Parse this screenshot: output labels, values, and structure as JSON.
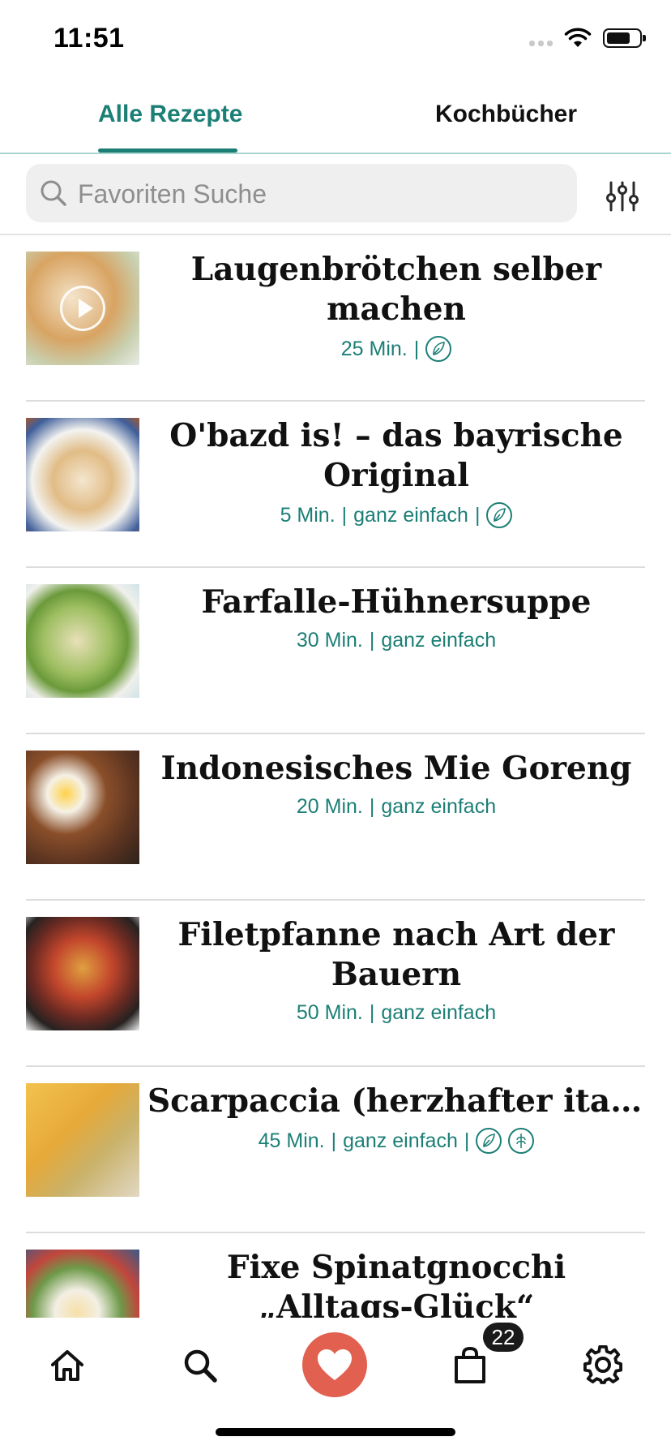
{
  "status_bar": {
    "time": "11:51"
  },
  "tabs": [
    {
      "label": "Alle Rezepte",
      "active": true
    },
    {
      "label": "Kochbücher",
      "active": false
    }
  ],
  "search": {
    "placeholder": "Favoriten Suche",
    "value": ""
  },
  "recipes": [
    {
      "title": "Laugenbrötchen selber machen",
      "time": "25 Min.",
      "difficulty": "",
      "badges": [
        "vegetarian-icon"
      ],
      "has_video": true
    },
    {
      "title": "O'bazd is! – das bayrische Original",
      "time": "5 Min.",
      "difficulty": "ganz einfach",
      "badges": [
        "vegetarian-icon"
      ],
      "has_video": false
    },
    {
      "title": "Farfalle-Hühnersuppe",
      "time": "30 Min.",
      "difficulty": "ganz einfach",
      "badges": [],
      "has_video": false
    },
    {
      "title": "Indonesisches Mie Goreng",
      "time": "20 Min.",
      "difficulty": "ganz einfach",
      "badges": [],
      "has_video": false
    },
    {
      "title": "Filetpfanne nach Art der Bauern",
      "time": "50 Min.",
      "difficulty": "ganz einfach",
      "badges": [],
      "has_video": false
    },
    {
      "title": "Scarpaccia (herzhafter italienischer Zucchinikuc…",
      "time": "45 Min.",
      "difficulty": "ganz einfach",
      "badges": [
        "vegetarian-icon",
        "gluten-free-icon"
      ],
      "has_video": false
    },
    {
      "title": "Fixe Spinatgnocchi „Alltags-Glück“",
      "time": "",
      "difficulty": "",
      "badges": [],
      "has_video": false
    }
  ],
  "bottom_nav": {
    "items": [
      "home-icon",
      "search-icon",
      "heart-icon",
      "shopping-bag-icon",
      "gear-icon"
    ],
    "cart_count": "22"
  },
  "colors": {
    "accent": "#1c7f76",
    "favorite": "#e2604f",
    "divider": "#dcdcdc"
  }
}
